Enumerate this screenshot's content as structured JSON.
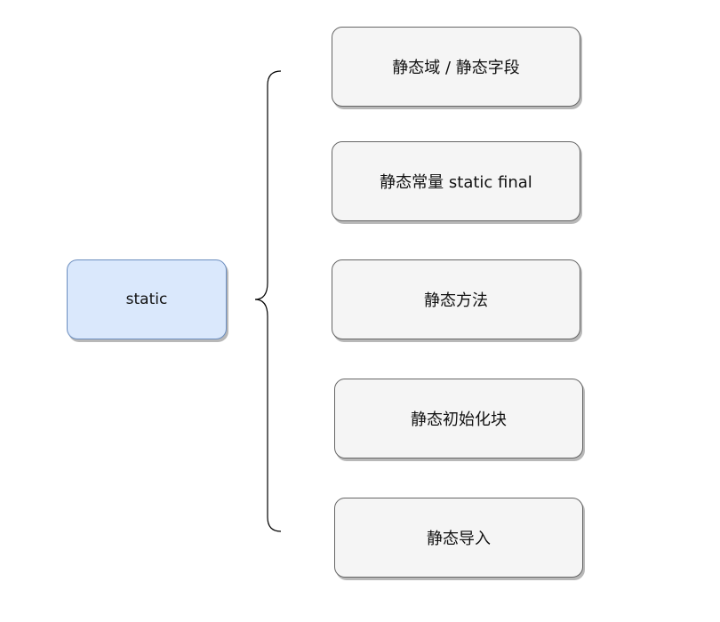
{
  "root": {
    "label": "static"
  },
  "children": [
    {
      "label": "静态域 / 静态字段"
    },
    {
      "label": "静态常量 static final"
    },
    {
      "label": "静态方法"
    },
    {
      "label": "静态初始化块"
    },
    {
      "label": "静态导入"
    }
  ],
  "colors": {
    "root_fill": "#dae8fc",
    "root_stroke": "#6c8ebf",
    "child_fill": "#f5f5f5",
    "child_stroke": "#666666",
    "brace": "#000000"
  }
}
